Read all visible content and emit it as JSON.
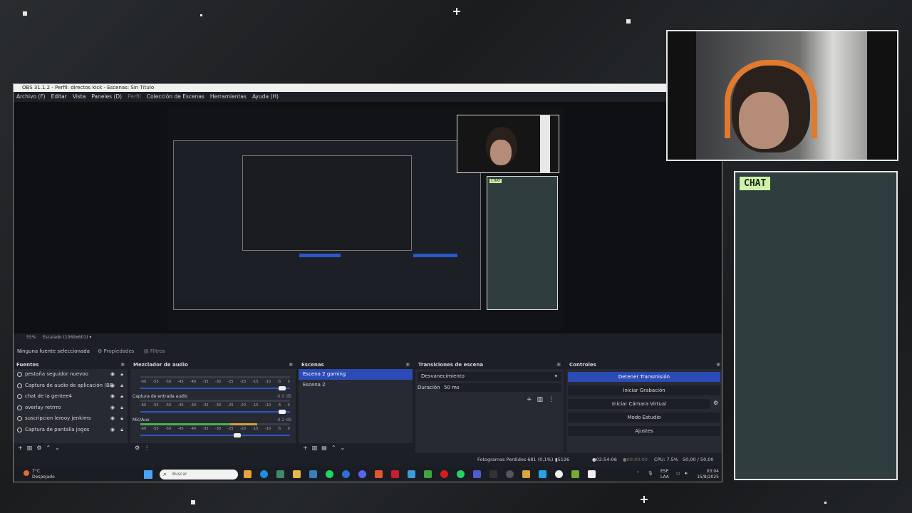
{
  "obs": {
    "title": "OBS 31.1.2 - Perfil: directos kick - Escenas: Sin Título",
    "menu": [
      {
        "label": "Archivo (F)",
        "dim": false
      },
      {
        "label": "Editar",
        "dim": false
      },
      {
        "label": "Vista",
        "dim": false
      },
      {
        "label": "Paneles (D)",
        "dim": false
      },
      {
        "label": "Perfil",
        "dim": true
      },
      {
        "label": "Colección de Escenas",
        "dim": false
      },
      {
        "label": "Herramientas",
        "dim": false
      },
      {
        "label": "Ayuda (H)",
        "dim": false
      }
    ],
    "zoom": "55%",
    "scaling": "Escalado (1069x601)",
    "no_source": "Ninguna fuente seleccionada",
    "properties": "Propiedades",
    "filters": "Filtros"
  },
  "overlay": {
    "chat_label": "CHAT",
    "mini_chat_label": "CHAT"
  },
  "sources": {
    "title": "Fuentes",
    "items": [
      "pestaña seguidor nuevoo",
      "Captura de audio de aplicación (BE",
      "chat de la gentee4",
      "overlay retrrro",
      "suscripcion lerooy jenkims",
      "Captura de pantalla jogos"
    ]
  },
  "mixer": {
    "title": "Mezclador de audio",
    "ticks": [
      "-60",
      "-55",
      "-50",
      "-45",
      "-40",
      "-35",
      "-30",
      "-25",
      "-20",
      "-15",
      "-10",
      "-5",
      "0"
    ],
    "channels": [
      {
        "name": "",
        "db": "",
        "level": 0.0,
        "fader": 0.97
      },
      {
        "name": "Captura de entrada audio",
        "db": "-0.0 dB",
        "level": 0.0,
        "fader": 0.97
      },
      {
        "name": "Mic/Aux",
        "db": "-8.2 dB",
        "level": 0.78,
        "fader": 0.67
      }
    ]
  },
  "scenes": {
    "title": "Escenas",
    "items": [
      {
        "label": "Escena 2 gaming",
        "selected": true
      },
      {
        "label": "Escena 2",
        "selected": false
      }
    ]
  },
  "transitions": {
    "title": "Transiciones de escena",
    "type": "Desvanecimiento",
    "duration_label": "Duración",
    "duration": "50 ms"
  },
  "controls": {
    "title": "Controles",
    "buttons": [
      {
        "label": "Detener Transmisión",
        "primary": true
      },
      {
        "label": "Iniciar Grabación",
        "primary": false
      },
      {
        "label": "Iniciar Cámara Virtual",
        "primary": false
      },
      {
        "label": "Modo Estudio",
        "primary": false
      },
      {
        "label": "Ajustes",
        "primary": false
      }
    ]
  },
  "status": {
    "dropped": "Fotogramas Perdidos 681 (0,1%)",
    "bitrate": "5126 kbps",
    "stream_time": "02:54:06",
    "rec_time": "00:00:00",
    "cpu": "CPU: 7.5%",
    "fps": "50,00 / 50,00 FPS"
  },
  "taskbar": {
    "temp": "7°C",
    "weather": "Despejado",
    "search_placeholder": "Buscar",
    "lang1": "ESP",
    "lang2": "LAA",
    "time": "03:04",
    "date": "15/8/2025"
  },
  "colors": {
    "accent": "#2b4bb7",
    "chat_bg": "#2f3d3f",
    "chat_label": "#cdf2a8",
    "headphones": "#e27a2d"
  }
}
